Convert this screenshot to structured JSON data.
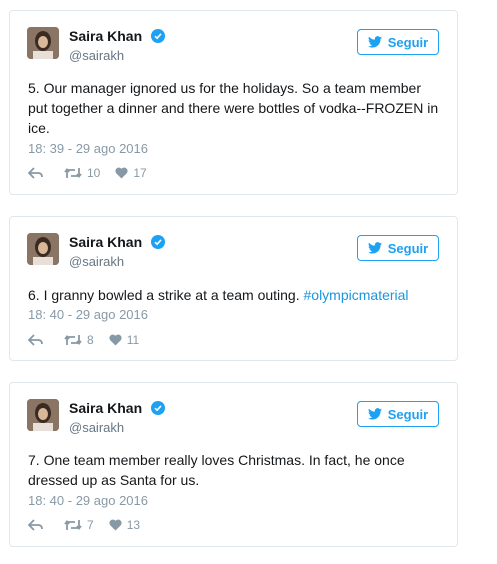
{
  "tweets": [
    {
      "author": "Saira Khan",
      "handle": "@sairakh",
      "follow_label": "Seguir",
      "text": "5. Our manager ignored us for the holidays. So a team member put together a dinner and there were bottles of vodka--FROZEN in ice.",
      "hashtag": "",
      "timestamp": "18: 39 - 29 ago 2016",
      "retweets": "10",
      "likes": "17"
    },
    {
      "author": "Saira Khan",
      "handle": "@sairakh",
      "follow_label": "Seguir",
      "text": "6. I granny bowled a strike at a team outing. ",
      "hashtag": "#olympicmaterial",
      "timestamp": "18: 40 - 29 ago 2016",
      "retweets": "8",
      "likes": "11"
    },
    {
      "author": "Saira Khan",
      "handle": "@sairakh",
      "follow_label": "Seguir",
      "text": "7. One team member really loves Christmas. In fact, he once dressed up as Santa for us.",
      "hashtag": "",
      "timestamp": "18: 40 - 29 ago 2016",
      "retweets": "7",
      "likes": "13"
    }
  ],
  "colors": {
    "accent": "#1da1f2",
    "muted": "#8899a6",
    "border": "#e1e8ed",
    "verified": "#1da1f2"
  },
  "icons": [
    "avatar-photo",
    "verified-badge-icon",
    "bird-icon",
    "reply-icon",
    "retweet-icon",
    "heart-icon"
  ]
}
